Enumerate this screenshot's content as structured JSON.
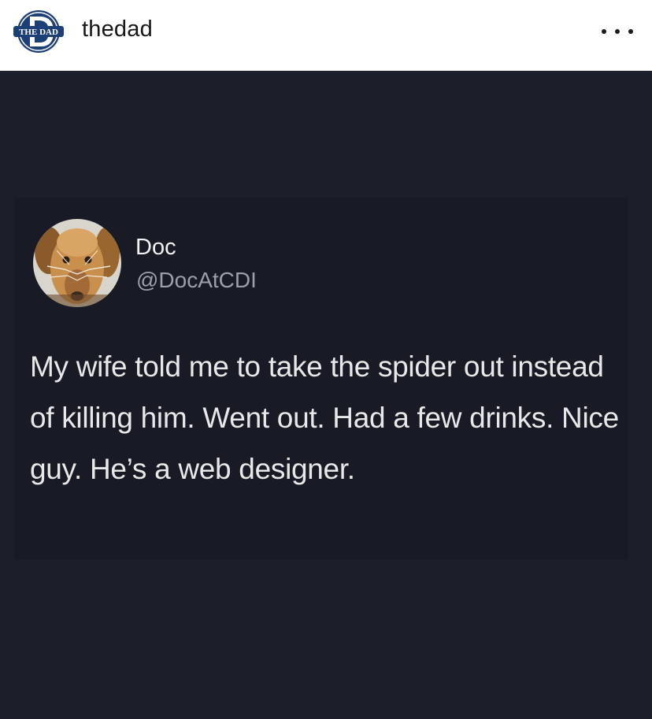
{
  "header": {
    "brand_logo_text": "THE DAD",
    "username": "thedad",
    "more_icon": "more-horizontal-icon"
  },
  "tweet": {
    "display_name": "Doc",
    "handle": "@DocAtCDI",
    "avatar_icon": "dog-avatar",
    "text": "My wife told me to take the spider out instead of killing him. Went out. Had a few drinks. Nice guy. He’s a web designer."
  },
  "colors": {
    "background": "#1b1f2a",
    "card": "#181b26",
    "text": "#e8e8e8",
    "handle": "#9aa0ab",
    "brand": "#1d3f78"
  }
}
